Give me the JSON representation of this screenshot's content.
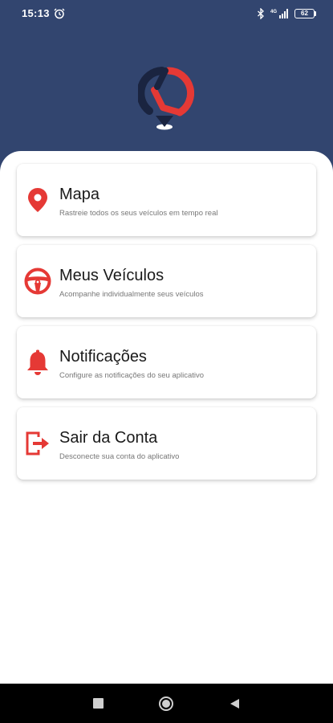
{
  "status_bar": {
    "time": "15:13",
    "battery": "62",
    "icons": [
      "alarm-icon",
      "bluetooth-icon",
      "signal-icon",
      "battery-icon"
    ]
  },
  "header": {
    "background_color": "#32456f",
    "logo": "app-logo-location-pin"
  },
  "accent_color": "#e53935",
  "menu": {
    "items": [
      {
        "title": "Mapa",
        "subtitle": "Rastreie todos os seus veículos em tempo real",
        "icon": "map-pin-icon"
      },
      {
        "title": "Meus Veículos",
        "subtitle": "Acompanhe individualmente seus veículos",
        "icon": "steering-wheel-icon"
      },
      {
        "title": "Notificações",
        "subtitle": "Configure as notificações do seu aplicativo",
        "icon": "bell-icon"
      },
      {
        "title": "Sair da Conta",
        "subtitle": "Desconecte sua conta do aplicativo",
        "icon": "logout-icon"
      }
    ]
  },
  "nav_bar": {
    "buttons": [
      "recent-apps-icon",
      "home-icon",
      "back-icon"
    ]
  }
}
